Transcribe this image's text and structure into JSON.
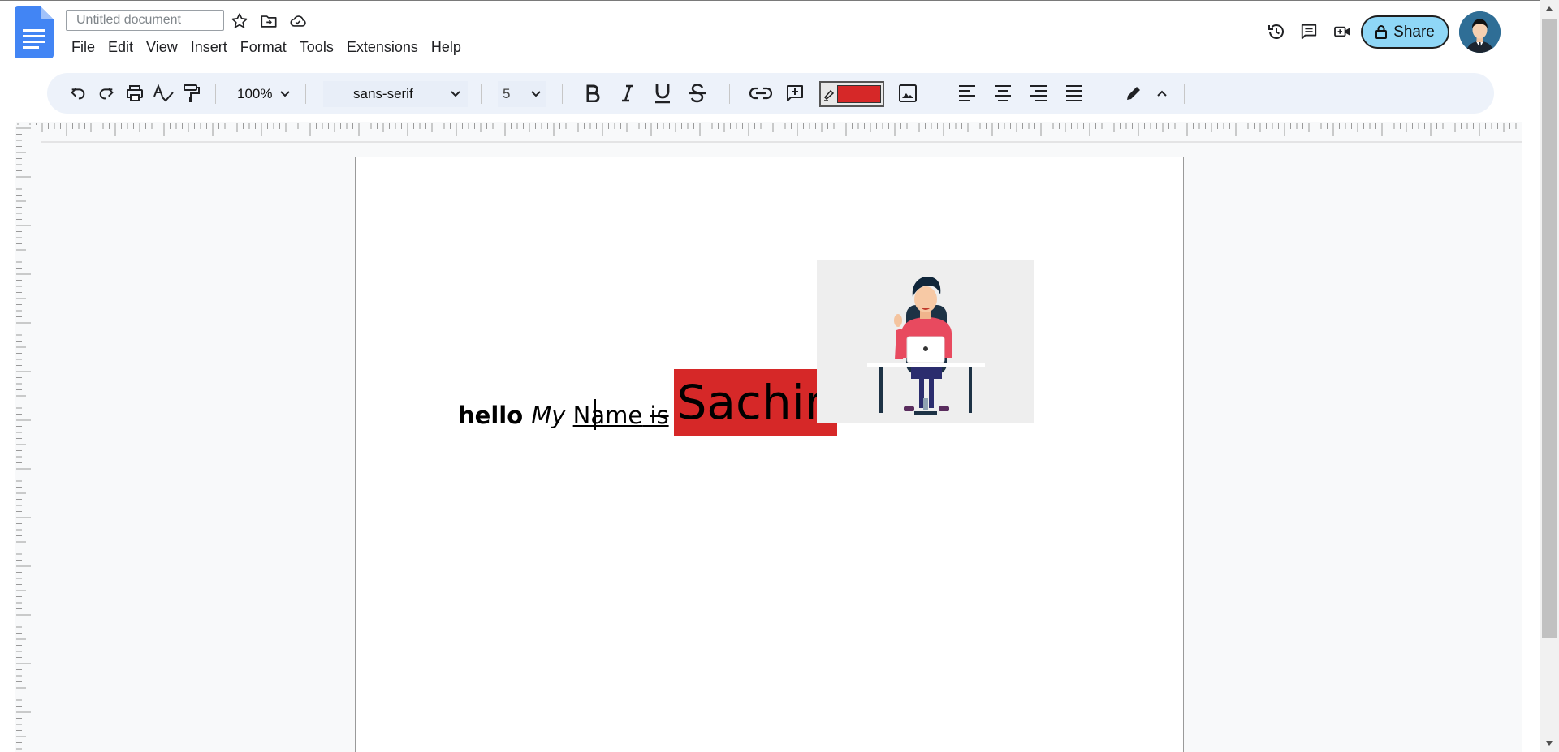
{
  "header": {
    "doc_title_placeholder": "Untitled document",
    "share_label": "Share",
    "menu": [
      "File",
      "Edit",
      "View",
      "Insert",
      "Format",
      "Tools",
      "Extensions",
      "Help"
    ]
  },
  "toolbar": {
    "zoom": "100%",
    "font": "sans-serif",
    "font_size": "5",
    "highlight_color": "#d62828"
  },
  "document": {
    "word_bold": "hello",
    "word_italic": "My",
    "word_underline": "Name",
    "word_strike": "is",
    "word_big": "Sachin",
    "big_word_bg": "#d62828"
  },
  "colors": {
    "share_bg": "#8fd7f7",
    "docs_blue": "#4285f4",
    "toolbar_bg": "#edf2fa"
  }
}
